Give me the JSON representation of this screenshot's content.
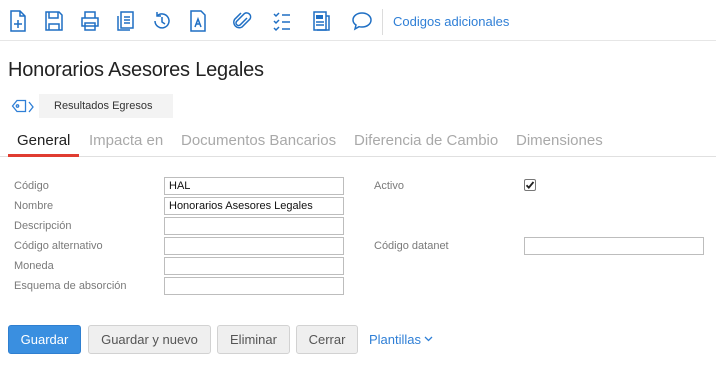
{
  "toolbar": {
    "icons": [
      {
        "name": "new-document-icon"
      },
      {
        "name": "save-icon"
      },
      {
        "name": "print-icon"
      },
      {
        "name": "copy-icon"
      },
      {
        "name": "history-icon"
      },
      {
        "name": "text-document-icon"
      },
      {
        "name": "attachment-icon"
      },
      {
        "name": "checklist-icon"
      },
      {
        "name": "notes-icon"
      },
      {
        "name": "comment-icon"
      }
    ],
    "codigos_adicionales": "Codigos adicionales"
  },
  "page": {
    "title": "Honorarios Asesores Legales"
  },
  "breadcrumb": {
    "tag": "Resultados Egresos"
  },
  "tabs": [
    {
      "label": "General",
      "active": true
    },
    {
      "label": "Impacta en",
      "active": false
    },
    {
      "label": "Documentos Bancarios",
      "active": false
    },
    {
      "label": "Diferencia de Cambio",
      "active": false
    },
    {
      "label": "Dimensiones",
      "active": false
    }
  ],
  "form": {
    "codigo": {
      "label": "Código",
      "value": "HAL"
    },
    "nombre": {
      "label": "Nombre",
      "value": "Honorarios Asesores Legales"
    },
    "descripcion": {
      "label": "Descripción",
      "value": ""
    },
    "codigo_alternativo": {
      "label": "Código alternativo",
      "value": ""
    },
    "moneda": {
      "label": "Moneda",
      "value": ""
    },
    "esquema_absorcion": {
      "label": "Esquema de absorción",
      "value": ""
    },
    "activo": {
      "label": "Activo",
      "checked": true
    },
    "codigo_datanet": {
      "label": "Código datanet",
      "value": ""
    }
  },
  "actions": {
    "guardar": "Guardar",
    "guardar_nuevo": "Guardar y nuevo",
    "eliminar": "Eliminar",
    "cerrar": "Cerrar",
    "plantillas": "Plantillas"
  },
  "colors": {
    "accent_blue": "#3a8fe0",
    "link_blue": "#2f7fd6",
    "icon_blue": "#1f6fc4",
    "tab_underline_red": "#e03c31"
  }
}
